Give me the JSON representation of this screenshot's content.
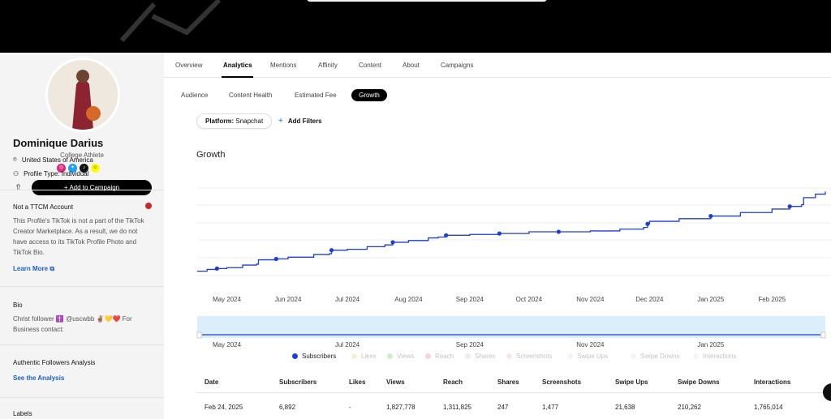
{
  "profile": {
    "name": "Dominique Darius",
    "role": "College Athlete",
    "socials": [
      "instagram-icon",
      "twitter-icon",
      "tiktok-icon",
      "snapchat-icon"
    ],
    "add_to_campaign": "Add to Campaign",
    "location": "United States of America",
    "profile_type": "Profile Type: Individual"
  },
  "ttcm": {
    "title": "Not a TTCM Account",
    "body": "This Profile's TikTok is not a part of the TikTok Creator Marketplace. As a result, we do not have access to its TikTok Profile Photo and TikTok Bio.",
    "link": "Learn More"
  },
  "bio": {
    "title": "Bio",
    "text": "Christ follower ✝️ @uscwbb ✌🏽💛❤️ For Business contact:"
  },
  "authentic": {
    "title": "Authentic Followers Analysis",
    "link": "See the Analysis"
  },
  "labels": {
    "title": "Labels"
  },
  "main_tabs": [
    "Overview",
    "Analytics",
    "Mentions",
    "Affinity",
    "Content",
    "About",
    "Campaigns"
  ],
  "active_main_tab": "Analytics",
  "sub_tabs": [
    "Audience",
    "Content Health",
    "Estimated Fee",
    "Growth"
  ],
  "active_sub_tab": "Growth",
  "filters": {
    "platform_label": "Platform:",
    "platform_value": "Snapchat",
    "add_filters": "Add Filters"
  },
  "chart_data": {
    "type": "line",
    "title": "Growth",
    "x_ticks": [
      "May 2024",
      "Jun 2024",
      "Jul 2024",
      "Aug 2024",
      "Sep 2024",
      "Oct 2024",
      "Nov 2024",
      "Dec 2024",
      "Jan 2025",
      "Feb 2025"
    ],
    "navigator_ticks": [
      "May 2024",
      "Jul 2024",
      "Sep 2024",
      "Nov 2024",
      "Jan 2025"
    ],
    "series": [
      {
        "name": "Subscribers",
        "color": "#1d3fd6",
        "points": [
          [
            "2024-04-16",
            0.05
          ],
          [
            "2024-04-21",
            0.07
          ],
          [
            "2024-04-26",
            0.08
          ],
          [
            "2024-05-01",
            0.09
          ],
          [
            "2024-05-09",
            0.12
          ],
          [
            "2024-05-16",
            0.13
          ],
          [
            "2024-05-17",
            0.18
          ],
          [
            "2024-05-26",
            0.19
          ],
          [
            "2024-06-01",
            0.21
          ],
          [
            "2024-06-14",
            0.24
          ],
          [
            "2024-06-22",
            0.25
          ],
          [
            "2024-06-23",
            0.29
          ],
          [
            "2024-07-01",
            0.3
          ],
          [
            "2024-07-11",
            0.33
          ],
          [
            "2024-07-20",
            0.35
          ],
          [
            "2024-07-24",
            0.38
          ],
          [
            "2024-08-01",
            0.4
          ],
          [
            "2024-08-11",
            0.43
          ],
          [
            "2024-08-16",
            0.44
          ],
          [
            "2024-08-20",
            0.46
          ],
          [
            "2024-09-01",
            0.47
          ],
          [
            "2024-09-16",
            0.48
          ],
          [
            "2024-10-01",
            0.5
          ],
          [
            "2024-10-16",
            0.5
          ],
          [
            "2024-11-01",
            0.51
          ],
          [
            "2024-11-16",
            0.53
          ],
          [
            "2024-11-28",
            0.55
          ],
          [
            "2024-11-30",
            0.59
          ],
          [
            "2024-12-01",
            0.62
          ],
          [
            "2024-12-16",
            0.65
          ],
          [
            "2025-01-01",
            0.68
          ],
          [
            "2025-01-16",
            0.72
          ],
          [
            "2025-02-01",
            0.76
          ],
          [
            "2025-02-10",
            0.79
          ],
          [
            "2025-02-16",
            0.81
          ],
          [
            "2025-02-17",
            0.89
          ],
          [
            "2025-02-23",
            0.93
          ],
          [
            "2025-02-28",
            0.96
          ]
        ],
        "markers": [
          "2024-04-26",
          "2024-05-26",
          "2024-06-23",
          "2024-07-24",
          "2024-08-20",
          "2024-09-16",
          "2024-10-16",
          "2024-11-30",
          "2025-01-01",
          "2025-02-10"
        ]
      }
    ],
    "legend": [
      "Subscribers",
      "Likes",
      "Views",
      "Reach",
      "Shares",
      "Screenshots",
      "Swipe Ups",
      "Swipe Downs",
      "Interactions"
    ],
    "legend_colors": [
      "#1d3fd6",
      "#f6f0d2",
      "#cfeccd",
      "#f6d4dc",
      "#ececf2",
      "#fbe3f2",
      "#f4f4f4",
      "#f4f4f4",
      "#f4f4f4"
    ],
    "grid": true
  },
  "table": {
    "headers": [
      "Date",
      "Subscribers",
      "Likes",
      "Views",
      "Reach",
      "Shares",
      "Screenshots",
      "Swipe Ups",
      "Swipe Downs",
      "Interactions"
    ],
    "rows": [
      [
        "Feb 24, 2025",
        "6,892",
        "-",
        "1,827,778",
        "1,311,825",
        "247",
        "1,477",
        "21,638",
        "210,262",
        "1,765,014"
      ]
    ]
  }
}
